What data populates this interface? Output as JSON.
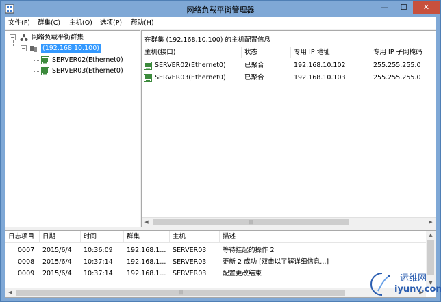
{
  "window": {
    "title": "网络负载平衡管理器",
    "minimize_glyph": "—",
    "maximize_glyph": "☐",
    "close_glyph": "✕"
  },
  "menu": [
    "文件(F)",
    "群集(C)",
    "主机(O)",
    "选项(P)",
    "帮助(H)"
  ],
  "tree": {
    "root_label": "网络负载平衡群集",
    "cluster_label": "(192.168.10.100)",
    "hosts": [
      "SERVER02(Ethernet0)",
      "SERVER03(Ethernet0)"
    ],
    "root_expander": "⊟",
    "cluster_expander": "⊟"
  },
  "right_pane": {
    "header": "在群集 (192.168.10.100) 的主机配置信息",
    "columns": [
      "主机(接口)",
      "状态",
      "专用 IP 地址",
      "专用 IP 子网掩码"
    ],
    "rows": [
      [
        "SERVER02(Ethernet0)",
        "已聚合",
        "192.168.10.102",
        "255.255.255.0"
      ],
      [
        "SERVER03(Ethernet0)",
        "已聚合",
        "192.168.10.103",
        "255.255.255.0"
      ]
    ]
  },
  "log": {
    "columns": [
      "日志项目",
      "日期",
      "时间",
      "群集",
      "主机",
      "描述"
    ],
    "rows": [
      [
        "0007",
        "2015/6/4",
        "10:36:09",
        "192.168.1...",
        "SERVER03",
        "等待挂起的操作 2"
      ],
      [
        "0008",
        "2015/6/4",
        "10:37:14",
        "192.168.1...",
        "SERVER03",
        "更新 2 成功 [双击以了解详细信息...]"
      ],
      [
        "0009",
        "2015/6/4",
        "10:37:14",
        "192.168.1...",
        "SERVER03",
        "配置更改结束"
      ]
    ]
  },
  "scroll": {
    "left_arrow": "◀",
    "right_arrow": "▶",
    "up_arrow": "▲",
    "down_arrow": "▼",
    "grip": "|||"
  },
  "watermark": {
    "line1": "运维网",
    "line2": "iyunv.com"
  },
  "colors": {
    "titlebar": "#7fa8d6",
    "selection": "#3399ff",
    "close_button": "#c7503d",
    "host_icon": "#3c8a3c"
  }
}
